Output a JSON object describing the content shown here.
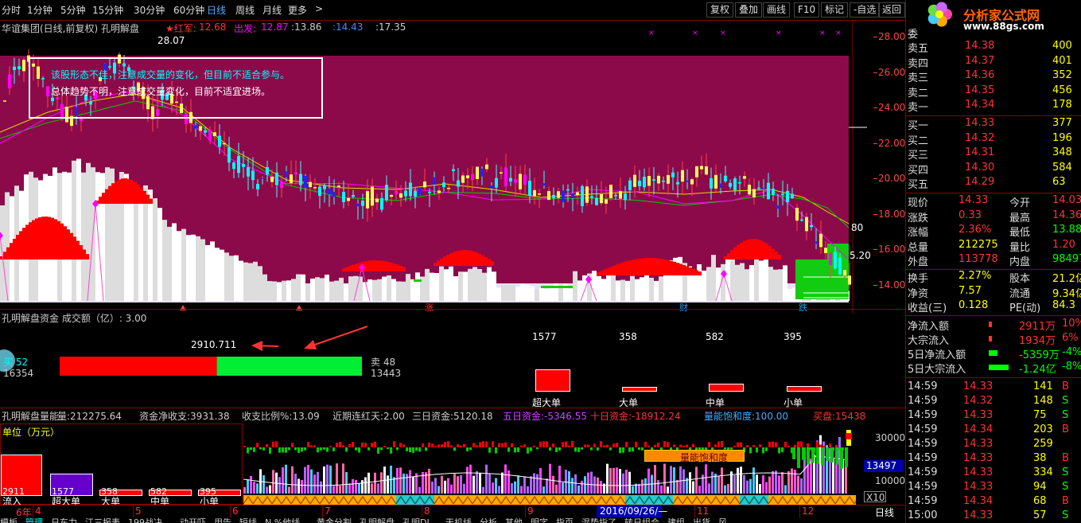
{
  "periods": [
    {
      "label": "分时",
      "active": false
    },
    {
      "label": "1分钟",
      "active": false
    },
    {
      "label": "5分钟",
      "active": false
    },
    {
      "label": "15分钟",
      "active": false
    },
    {
      "label": "30分钟",
      "active": false
    },
    {
      "label": "60分钟",
      "active": false
    },
    {
      "label": "日线",
      "active": true
    },
    {
      "label": "周线",
      "active": false
    },
    {
      "label": "月线",
      "active": false
    },
    {
      "label": "更多",
      "active": false
    }
  ],
  "more_arrow": ">",
  "tools": [
    "复权",
    "叠加",
    "画线",
    "F10",
    "标记",
    "-自选",
    "返回"
  ],
  "logo": {
    "text": "分析家公式网",
    "url": "www.88gs.com"
  },
  "main_info": {
    "title": "华谊集团(日线,前复权) 孔明解盘",
    "hongjun_label": "★红军:",
    "hongjun_value": "12.68",
    "chufa_label": "出发:",
    "chufa_value": "12.87",
    "v3": ":13.86",
    "v4": ":14.43",
    "v5": ":17.35"
  },
  "peak_label": "28.07",
  "info_box": {
    "line1": "该股形态不佳，注意成交量的变化，但目前不适合参与。",
    "line2": "总体趋势不明，注意成交量变化，目前不适宜进场。"
  },
  "price_axis": [
    "28.00",
    "26.00",
    "24.00",
    "22.00",
    "20.00",
    "18.00",
    "16.00",
    "14.00"
  ],
  "price_levels": {
    "max": 28.0,
    "min": 14.0
  },
  "side_labels": {
    "a": "80",
    "b": "5.20"
  },
  "markers": [
    "涨",
    "财",
    "跌"
  ],
  "capital": {
    "title": "孔明解盘资金 成交额（亿）: 3.00",
    "buy_label": "买 52",
    "buy_value": "16354",
    "bar_top_value": "2910.711",
    "sell_label": "卖 48",
    "sell_value": "13443",
    "buy_ratio": 0.52,
    "orders": [
      {
        "label": "超大单",
        "value": "1577",
        "ratio": 1.0
      },
      {
        "label": "大单",
        "value": "358",
        "ratio": 0.23
      },
      {
        "label": "中单",
        "value": "582",
        "ratio": 0.37
      },
      {
        "label": "小单",
        "value": "395",
        "ratio": 0.25
      }
    ]
  },
  "energy": {
    "title": "孔明解盘量能",
    "items": [
      {
        "label": "量:",
        "value": "212275.64",
        "color": "#ccc"
      },
      {
        "label": "资金净收支:",
        "value": "3931.38",
        "color": "#ccc"
      },
      {
        "label": "收支比例%:",
        "value": "13.09",
        "color": "#ccc"
      },
      {
        "label": "近期连红天:",
        "value": "2.00",
        "color": "#ccc"
      },
      {
        "label": "三日资金:",
        "value": "5120.18",
        "color": "#ccc"
      },
      {
        "label": "五日资金:",
        "value": "-5346.55",
        "color": "#c4f"
      },
      {
        "label": "十日资金:",
        "value": "-18912.24",
        "color": "#f33"
      },
      {
        "label": "量能饱和度:",
        "value": "100.00",
        "color": "#4af"
      },
      {
        "label": "买盘:",
        "value": "15438",
        "color": "#f33"
      }
    ],
    "unit_label": "单位（万元）",
    "unit_bars": [
      {
        "label": "流入",
        "value": "2911",
        "ratio": 1.0,
        "color": "#f00"
      },
      {
        "label": "超大单",
        "value": "1577",
        "ratio": 0.54,
        "color": "#60c"
      },
      {
        "label": "大单",
        "value": "358",
        "ratio": 0.12,
        "color": "#f00"
      },
      {
        "label": "中单",
        "value": "582",
        "ratio": 0.15,
        "color": "#f00"
      },
      {
        "label": "小单",
        "value": "395",
        "ratio": 0.12,
        "color": "#f00"
      }
    ],
    "saturation_label": "量能饱和度",
    "vol_axis": [
      "30000",
      "10000"
    ],
    "vol_mark": "13497",
    "x10": "X10"
  },
  "date_axis": {
    "year_label": "6年",
    "months": [
      "4",
      "5",
      "6",
      "7",
      "8",
      "9",
      "10",
      "11",
      "12"
    ],
    "date_box": "2016/09/26/—",
    "period": "日线"
  },
  "bottom_tabs": [
    "模板",
    "管理",
    "日东力",
    "江三报表",
    "199战决",
    "动开吓",
    "用告",
    "短线",
    "N.%他线",
    "黄金分割",
    "孔明解盘",
    "孔明DI",
    "天机线",
    "分析",
    "其他",
    "明字",
    "指页",
    "混势指了",
    "转日组合",
    "建组",
    "出货",
    "风"
  ],
  "quote": {
    "header": "委",
    "sells": [
      {
        "label": "卖五",
        "price": "14.38",
        "vol": "400"
      },
      {
        "label": "卖四",
        "price": "14.37",
        "vol": "401"
      },
      {
        "label": "卖三",
        "price": "14.36",
        "vol": "352"
      },
      {
        "label": "卖二",
        "price": "14.35",
        "vol": "456"
      },
      {
        "label": "卖一",
        "price": "14.34",
        "vol": "178"
      }
    ],
    "buys": [
      {
        "label": "买一",
        "price": "14.33",
        "vol": "377"
      },
      {
        "label": "买二",
        "price": "14.32",
        "vol": "196"
      },
      {
        "label": "买三",
        "price": "14.31",
        "vol": "348"
      },
      {
        "label": "买四",
        "price": "14.30",
        "vol": "584"
      },
      {
        "label": "买五",
        "price": "14.29",
        "vol": "63"
      }
    ],
    "stats": [
      {
        "l1": "现价",
        "v1": "14.33",
        "c1": "#f33",
        "l2": "今开",
        "v2": "14.03",
        "c2": "#f33"
      },
      {
        "l1": "涨跌",
        "v1": "0.33",
        "c1": "#f33",
        "l2": "最高",
        "v2": "14.36",
        "c2": "#f33"
      },
      {
        "l1": "涨幅",
        "v1": "2.36%",
        "c1": "#f33",
        "l2": "最低",
        "v2": "13.88",
        "c2": "#0f0"
      },
      {
        "l1": "总量",
        "v1": "212275",
        "c1": "#ff0",
        "l2": "量比",
        "v2": "1.20",
        "c2": "#f33"
      },
      {
        "l1": "外盘",
        "v1": "113778",
        "c1": "#f33",
        "l2": "内盘",
        "v2": "98497",
        "c2": "#0f0"
      },
      {
        "l1": "换手",
        "v1": "2.27%",
        "c1": "#ff0",
        "l2": "股本",
        "v2": "21.2亿",
        "c2": "#ff0"
      },
      {
        "l1": "净资",
        "v1": "7.57",
        "c1": "#ff0",
        "l2": "流通",
        "v2": "9.34亿",
        "c2": "#ff0"
      },
      {
        "l1": "收益(三)",
        "v1": "0.128",
        "c1": "#ff0",
        "l2": "PE(动)",
        "v2": "84.3",
        "c2": "#ff0"
      }
    ],
    "flows": [
      {
        "label": "净流入额",
        "value": "2911万",
        "pct": "10%",
        "color": "#f33",
        "bar": 0.05
      },
      {
        "label": "大宗流入",
        "value": "1934万",
        "pct": "6%",
        "color": "#f33",
        "bar": 0.04
      },
      {
        "label": "5日净流入额",
        "value": "-5359万",
        "pct": "-4%",
        "color": "#0f0",
        "bar": 0.3
      },
      {
        "label": "5日大宗流入",
        "value": "-1.24亿",
        "pct": "-8%",
        "color": "#0f0",
        "bar": 0.7
      }
    ],
    "ticks": [
      {
        "t": "14:59",
        "p": "14.33",
        "pc": "#f33",
        "v": "141",
        "bs": "B"
      },
      {
        "t": "14:59",
        "p": "14.32",
        "pc": "#f33",
        "v": "148",
        "bs": "S"
      },
      {
        "t": "14:59",
        "p": "14.33",
        "pc": "#f33",
        "v": "75",
        "bs": "S"
      },
      {
        "t": "14:59",
        "p": "14.34",
        "pc": "#f33",
        "v": "203",
        "bs": "B"
      },
      {
        "t": "14:59",
        "p": "14.33",
        "pc": "#f33",
        "v": "259",
        "bs": ""
      },
      {
        "t": "14:59",
        "p": "14.33",
        "pc": "#f33",
        "v": "38",
        "bs": "B"
      },
      {
        "t": "14:59",
        "p": "14.33",
        "pc": "#f33",
        "v": "334",
        "bs": "S"
      },
      {
        "t": "14:59",
        "p": "14.33",
        "pc": "#f33",
        "v": "94",
        "bs": "S"
      },
      {
        "t": "14:59",
        "p": "14.34",
        "pc": "#f33",
        "v": "68",
        "bs": "B"
      },
      {
        "t": "15:00",
        "p": "14.33",
        "pc": "#f33",
        "v": "57",
        "bs": "S"
      }
    ]
  }
}
